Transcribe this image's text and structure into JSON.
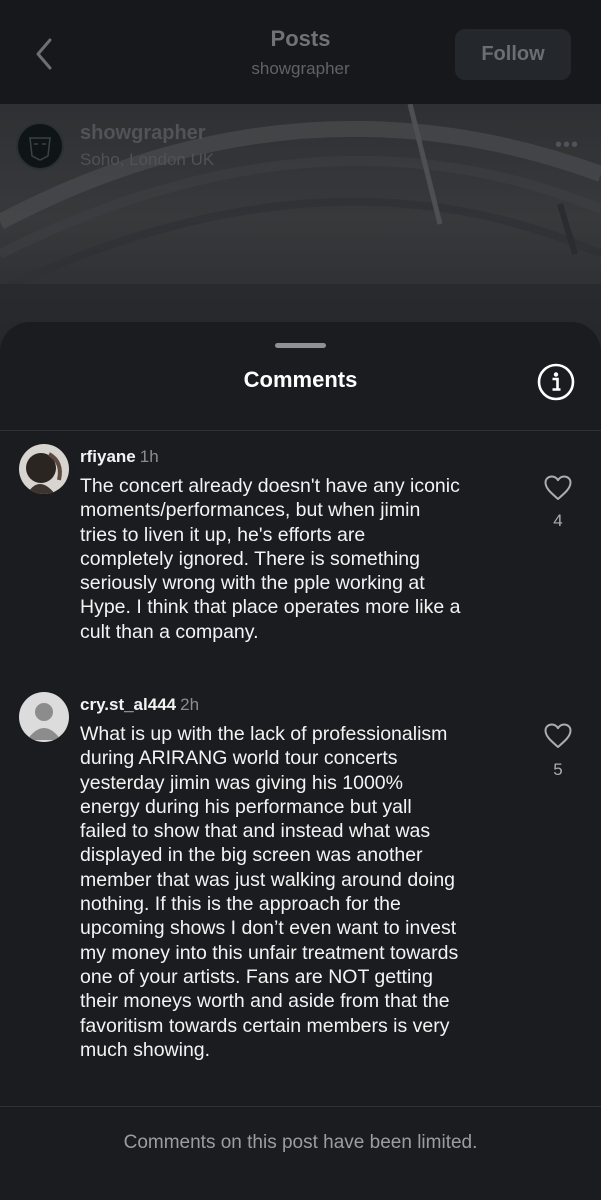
{
  "header": {
    "title": "Posts",
    "subtitle": "showgrapher",
    "follow_label": "Follow"
  },
  "post": {
    "username": "showgrapher",
    "location": "Soho, London UK",
    "more_label": "•••"
  },
  "sheet": {
    "title": "Comments"
  },
  "comments": [
    {
      "username": "rfiyane",
      "time": "1h",
      "lines": [
        "The concert already doesn't have any iconic",
        "moments/performances, but when jimin",
        "tries to liven it up, he's efforts are",
        "completely ignored. There is something",
        "seriously wrong with the pple working at",
        "Hype. I think that place operates more like a",
        "cult than a company."
      ],
      "likes": "4"
    },
    {
      "username": "cry.st_al444",
      "time": "2h",
      "lines": [
        "What is up with the lack of professionalism",
        "during ARIRANG world tour concerts",
        "yesterday jimin was giving his 1000%",
        "energy during his performance but yall",
        "failed to show that and instead what was",
        "displayed in the big screen was another",
        "member that was just walking around doing",
        "nothing. If this is the approach for the",
        "upcoming shows I don’t even want to invest",
        "my money into this unfair treatment towards",
        "one of your artists. Fans are NOT getting",
        "their moneys worth and aside from that the",
        "favoritism towards certain members is very",
        "much showing."
      ],
      "likes": "5"
    }
  ],
  "footer": {
    "limited_notice": "Comments on this post have been limited."
  },
  "icons": {
    "back": "chevron-left-icon",
    "info": "info-icon",
    "like": "heart-outline-icon",
    "default_avatar": "person-icon"
  }
}
